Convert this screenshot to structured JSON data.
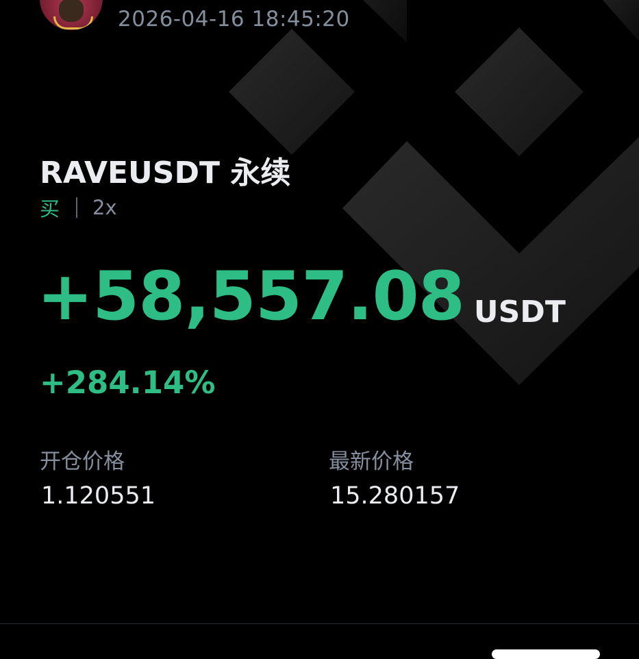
{
  "header": {
    "timestamp": "2026-04-16 18:45:20",
    "avatar_icon": "user-avatar-icon"
  },
  "position": {
    "symbol": "RAVEUSDT 永续",
    "side": "买",
    "leverage": "2x",
    "pnl": "+58,557.08",
    "pnl_unit": "USDT",
    "roi": "+284.14%"
  },
  "fields": {
    "entry_label": "开仓价格",
    "entry_value": "1.120551",
    "last_label": "最新价格",
    "last_value": "15.280157"
  },
  "colors": {
    "profit_green": "#2ebd85",
    "background": "#000000",
    "text_primary": "#eaecef",
    "text_secondary": "#848e9c"
  },
  "background_logo_icon": "binance-diamond-logo-icon"
}
